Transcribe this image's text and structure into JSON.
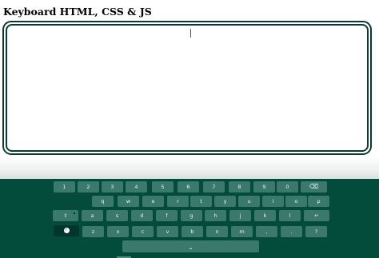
{
  "page": {
    "title": "Keyboard HTML, CSS & JS"
  },
  "textarea": {
    "value": ""
  },
  "keyboard": {
    "row1": [
      "1",
      "2",
      "3",
      "4",
      "5",
      "6",
      "7",
      "8",
      "9",
      "0"
    ],
    "row2": [
      "q",
      "w",
      "e",
      "r",
      "t",
      "y",
      "u",
      "i",
      "o",
      "p"
    ],
    "row3": [
      "a",
      "s",
      "d",
      "f",
      "g",
      "h",
      "j",
      "k",
      "l"
    ],
    "row4": [
      "z",
      "x",
      "c",
      "v",
      "b",
      "n",
      "m",
      ",",
      ".",
      "?"
    ],
    "icons": {
      "backspace": "⌫",
      "caps": "⇧",
      "enter": "↵",
      "done": "✓",
      "space": "⎵"
    },
    "colors": {
      "background": "#034c3c",
      "key": "#3b7a6b",
      "key_dark": "#01372b",
      "key_text": "#e9f4f0",
      "textarea_border": "#0a3b30"
    }
  }
}
